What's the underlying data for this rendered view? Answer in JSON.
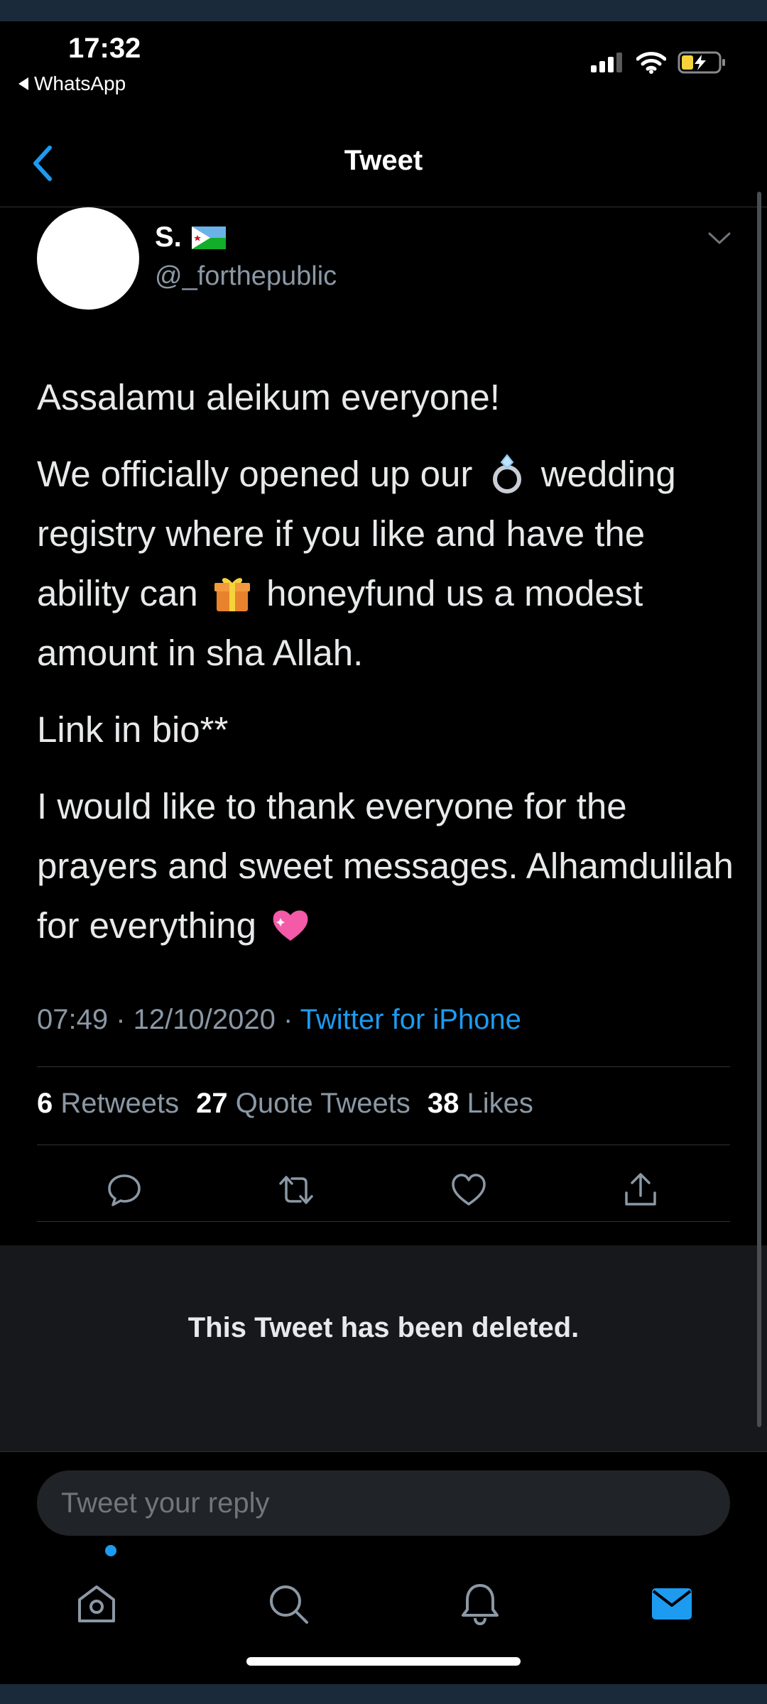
{
  "status_bar": {
    "time": "17:32",
    "back_app": "WhatsApp",
    "icons": [
      "signal-icon",
      "wifi-icon",
      "battery-charging-icon"
    ]
  },
  "header": {
    "title": "Tweet",
    "back_icon": "chevron-left-icon"
  },
  "tweet": {
    "display_name": "S.",
    "flag": "djibouti-flag",
    "handle": "@_forthepublic",
    "paragraphs": {
      "p1": "Assalamu aleikum everyone!",
      "p2_a": "We officially opened up our",
      "p2_b": "wedding registry where if you like and have the ability can",
      "p2_c": "honeyfund us a modest amount in sha Allah.",
      "p3": "Link in bio**",
      "p4": "I would like to thank everyone for the prayers and sweet messages. Alhamdulilah for everything"
    },
    "timestamp": "07:49 · 12/10/2020 ·",
    "source": "Twitter for iPhone",
    "stats": {
      "retweets_count": "6",
      "retweets_label": "Retweets",
      "quotes_count": "27",
      "quotes_label": "Quote Tweets",
      "likes_count": "38",
      "likes_label": "Likes"
    },
    "actions": [
      "reply-icon",
      "retweet-icon",
      "like-icon",
      "share-icon"
    ]
  },
  "deleted_notice": "This Tweet has been deleted.",
  "reply": {
    "placeholder": "Tweet your reply"
  },
  "tab_bar": [
    "home-icon",
    "search-icon",
    "notifications-icon",
    "messages-icon"
  ],
  "colors": {
    "background": "#000000",
    "accent": "#1d9bf0",
    "secondary_text": "#8b98a5"
  }
}
